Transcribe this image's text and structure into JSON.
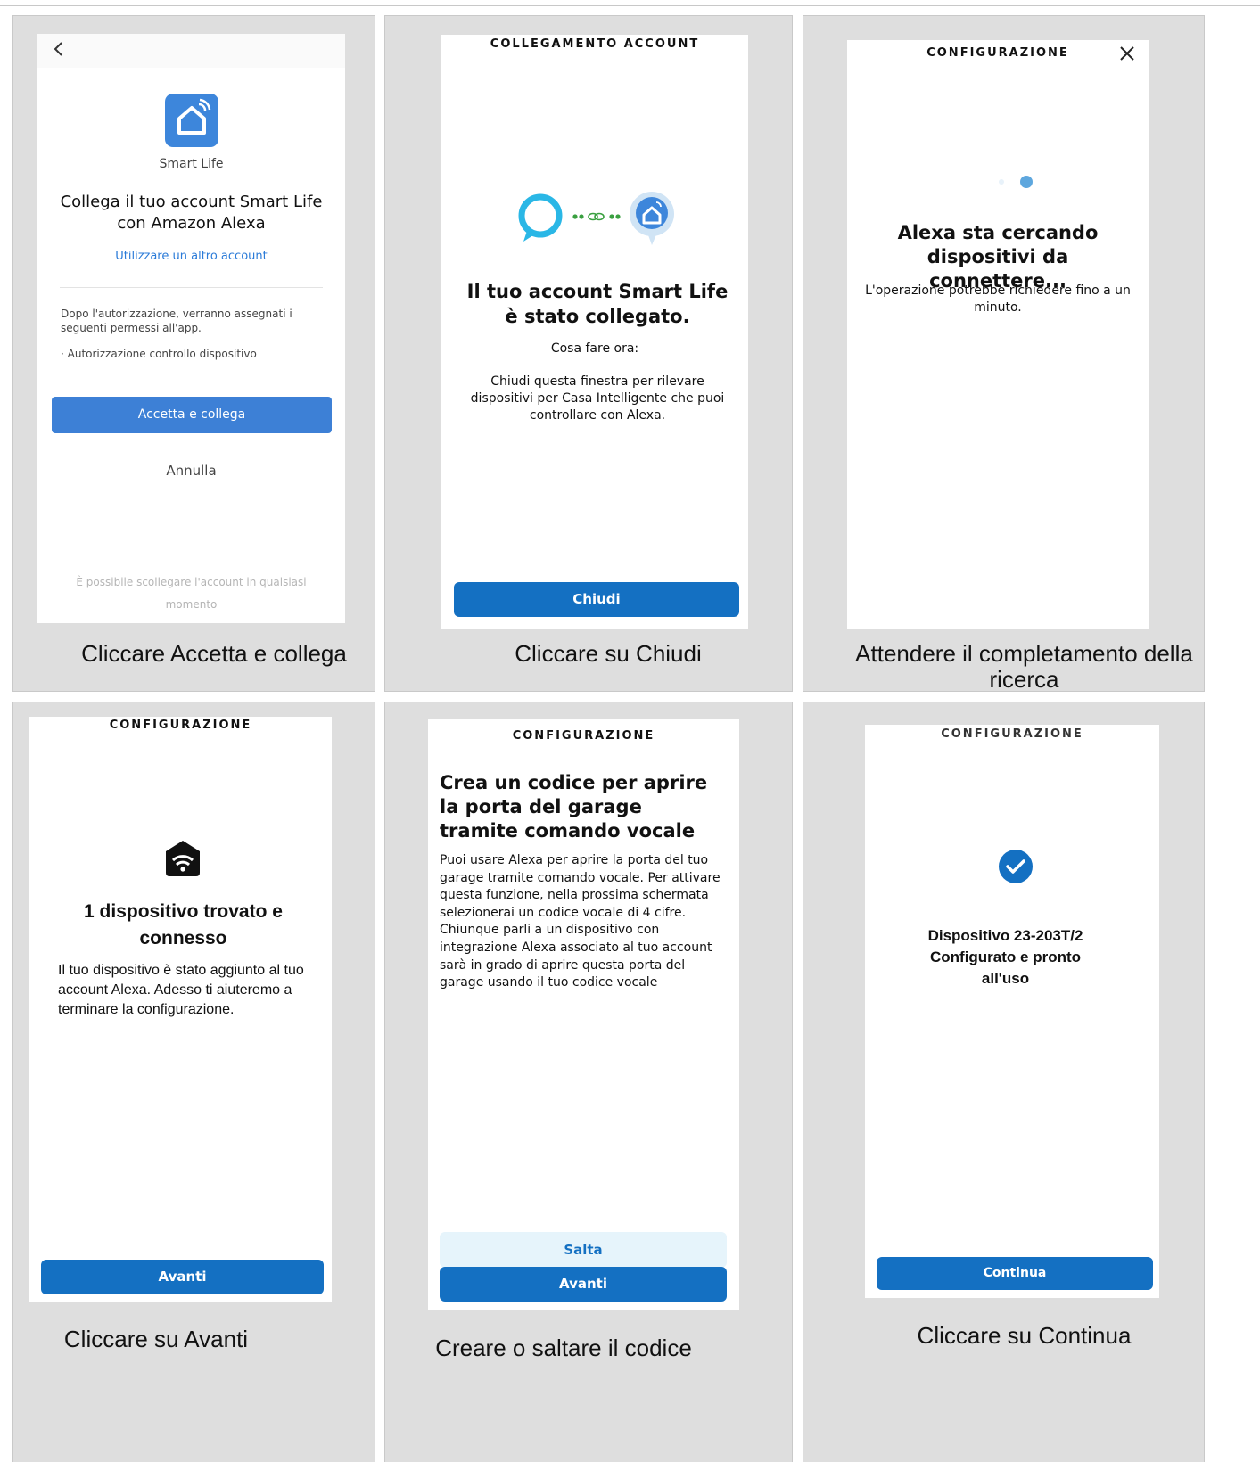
{
  "panels": {
    "p1": {
      "app_name": "Smart Life",
      "title": "Collega il tuo account Smart Life con Amazon Alexa",
      "link": "Utilizzare un altro account",
      "permissions_intro": "Dopo l'autorizzazione, verranno assegnati i seguenti permessi all'app.",
      "permission_item": "· Autorizzazione controllo dispositivo",
      "accept_button": "Accetta e collega",
      "cancel": "Annulla",
      "footer": "È possibile scollegare l'account in qualsiasi momento",
      "caption": "Cliccare Accetta e collega"
    },
    "p2": {
      "header": "COLLEGAMENTO ACCOUNT",
      "title": "Il tuo account Smart Life è stato collegato.",
      "subtitle": "Cosa fare ora:",
      "body": "Chiudi questa finestra per rilevare dispositivi per Casa Intelligente che puoi controllare con Alexa.",
      "button": "Chiudi",
      "caption": "Cliccare su Chiudi"
    },
    "p3": {
      "header": "CONFIGURAZIONE",
      "title": "Alexa sta cercando dispositivi da connettere...",
      "body": "L'operazione potrebbe richiedere fino a un minuto.",
      "caption": "Attendere il completamento della ricerca"
    },
    "p4": {
      "header": "CONFIGURAZIONE",
      "title": "1 dispositivo trovato e connesso",
      "body": "Il tuo dispositivo è stato aggiunto al tuo account Alexa. Adesso ti aiuteremo a terminare la configurazione.",
      "button": "Avanti",
      "caption": "Cliccare su Avanti"
    },
    "p5": {
      "header": "CONFIGURAZIONE",
      "title": "Crea un codice per aprire la porta del garage tramite comando vocale",
      "body": "Puoi usare Alexa per aprire la porta del tuo garage tramite comando vocale. Per attivare questa funzione, nella prossima schermata selezionerai un codice vocale di 4 cifre. Chiunque parli a un dispositivo con integrazione Alexa associato al tuo account sarà in grado di aprire questa porta del garage usando il tuo codice vocale",
      "skip_button": "Salta",
      "next_button": "Avanti",
      "caption": "Creare o  saltare il codice"
    },
    "p6": {
      "header": "CONFIGURAZIONE",
      "title_line1": "Dispositivo 23-203T/2",
      "title_line2": "Configurato e pronto",
      "title_line3": "all'uso",
      "button": "Continua",
      "caption": "Cliccare su Continua"
    }
  },
  "colors": {
    "cell_bg": "#dedede",
    "smart_life_blue": "#3d86db",
    "alexa_blue": "#1470c2",
    "link_blue": "#2b7bd8",
    "alexa_ring": "#2ab7e6",
    "link_green": "#3aa040",
    "skip_bg": "#e6f4fb"
  },
  "icons": [
    "back-chevron-icon",
    "smart-life-home-icon",
    "alexa-ring-icon",
    "link-chain-icon",
    "smart-home-bubble-icon",
    "close-icon",
    "loading-dots-icon",
    "garage-wifi-icon",
    "checkmark-icon"
  ]
}
